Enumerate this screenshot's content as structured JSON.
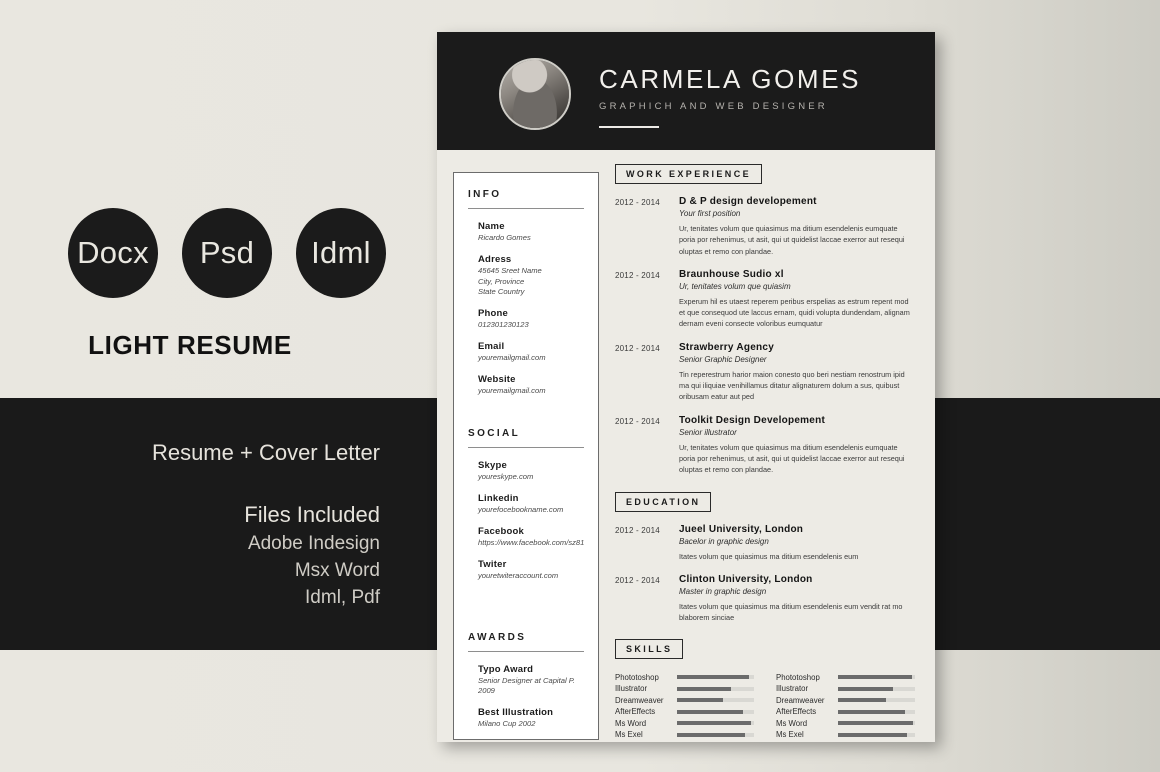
{
  "promo": {
    "formats": [
      {
        "label": "Docx"
      },
      {
        "label": "Psd"
      },
      {
        "label": "Idml"
      }
    ],
    "headline": "LIGHT RESUME",
    "tagline": "Resume + Cover Letter",
    "files_title": "Files Included",
    "files": [
      "Adobe Indesign",
      "Msx Word",
      "Idml, Pdf"
    ],
    "colors": {
      "dark": "#1a1a1a",
      "paper": "#e7e5de"
    }
  },
  "resume": {
    "header": {
      "name": "CARMELA GOMES",
      "job_title": "GRAPHICH AND WEB DESIGNER",
      "avatar_alt": "portrait-photo"
    },
    "sidebar": {
      "sections": [
        {
          "heading": "INFO",
          "items": [
            {
              "key": "Name",
              "value": "Ricardo Gomes"
            },
            {
              "key": "Adress",
              "value": "45645 Sreet Name\nCity, Province\nState Country"
            },
            {
              "key": "Phone",
              "value": "012301230123"
            },
            {
              "key": "Email",
              "value": "youremailgmail.com"
            },
            {
              "key": "Website",
              "value": "youremailgmail.com"
            }
          ]
        },
        {
          "heading": "SOCIAL",
          "items": [
            {
              "key": "Skype",
              "value": "youreskype.com"
            },
            {
              "key": "Linkedin",
              "value": "yourefocebookname.com"
            },
            {
              "key": "Facebook",
              "value": "https://www.facebook.com/sz81"
            },
            {
              "key": "Twiter",
              "value": "youretwiteraccount.com"
            }
          ]
        },
        {
          "heading": "AWARDS",
          "items": [
            {
              "key": "Typo Award",
              "value": "Senior Designer at Capital P. 2009"
            },
            {
              "key": "Best Illustration",
              "value": "Milano Cup 2002"
            }
          ]
        }
      ]
    },
    "work": {
      "heading": "WORK EXPERIENCE",
      "entries": [
        {
          "period": "2012 - 2014",
          "role": "D & P design developement",
          "subtitle": "Your first position",
          "description": "Ur, tenitates volum que quiasimus ma ditium esendelenis eumquate poria por rehenimus, ut asit, qui ut quidelist laccae exerror aut resequi oluptas et remo con plandae."
        },
        {
          "period": "2012 - 2014",
          "role": "Braunhouse Sudio xl",
          "subtitle": "Ur, tenitates volum que quiasim",
          "description": "Experum hil es utaest reperem peribus erspelias as estrum repent mod et que consequod ute laccus ernam, quidi volupta dundendam, alignam dernam eveni consecte voloribus eumquatur"
        },
        {
          "period": "2012 - 2014",
          "role": "Strawberry Agency",
          "subtitle": "Senior Graphic Designer",
          "description": "Tin reperestrum harior maion conesto quo beri nestiam renostrum ipid ma qui iliquiae venihillamus ditatur alignaturem dolum a sus, quibust oribusam eatur aut ped"
        },
        {
          "period": "2012 - 2014",
          "role": "Toolkit Design Developement",
          "subtitle": "Senior illustrator",
          "description": "Ur, tenitates volum que quiasimus ma ditium esendelenis eumquate poria por rehenimus, ut asit, qui ut quidelist laccae exerror aut resequi oluptas et remo con plandae."
        }
      ]
    },
    "education": {
      "heading": "EDUCATION",
      "entries": [
        {
          "period": "2012 - 2014",
          "role": "Jueel University, London",
          "subtitle": "Bacelor in graphic design",
          "description": "Itates volum que quiasimus ma ditium esendelenis eum"
        },
        {
          "period": "2012 - 2014",
          "role": "Clinton University, London",
          "subtitle": "Master in graphic design",
          "description": "Itates volum que quiasimus ma ditium esendelenis eum vendit rat mo blaborem sinciae"
        }
      ]
    },
    "skills": {
      "heading": "SKILLS",
      "columns": [
        {
          "items": [
            {
              "label": "Phototoshop",
              "level": 94
            },
            {
              "label": "Illustrator",
              "level": 70
            },
            {
              "label": "Dreamweaver",
              "level": 60
            },
            {
              "label": "AfterEffects",
              "level": 86
            },
            {
              "label": "Ms Word",
              "level": 96
            },
            {
              "label": "Ms Exel",
              "level": 88
            }
          ]
        },
        {
          "items": [
            {
              "label": "Phototoshop",
              "level": 96
            },
            {
              "label": "Illustrator",
              "level": 71
            },
            {
              "label": "Dreamweaver",
              "level": 62
            },
            {
              "label": "AfterEffects",
              "level": 87
            },
            {
              "label": "Ms Word",
              "level": 97
            },
            {
              "label": "Ms Exel",
              "level": 90
            }
          ]
        }
      ]
    }
  }
}
